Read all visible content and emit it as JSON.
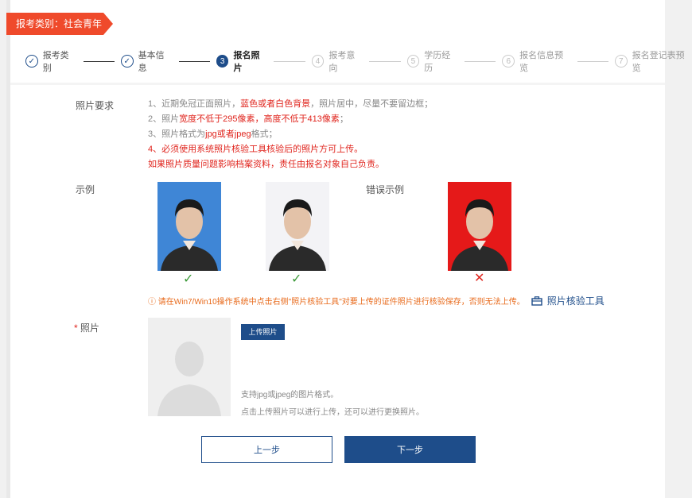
{
  "ribbon": {
    "text": "报考类别：社会青年"
  },
  "steps": [
    {
      "num": "✓",
      "label": "报考类别"
    },
    {
      "num": "✓",
      "label": "基本信息"
    },
    {
      "num": "3",
      "label": "报名照片"
    },
    {
      "num": "4",
      "label": "报考意向"
    },
    {
      "num": "5",
      "label": "学历经历"
    },
    {
      "num": "6",
      "label": "报名信息预览"
    },
    {
      "num": "7",
      "label": "报名登记表预览"
    }
  ],
  "requirements": {
    "label": "照片要求",
    "line1_a": "1、近期免冠正面照片，",
    "line1_b": "蓝色或者白色背景",
    "line1_c": "，照片居中，尽量不要留边框；",
    "line2_a": "2、照片",
    "line2_b": "宽度不低于295像素，高度不低于413像素",
    "line2_c": "；",
    "line3_a": "3、照片格式为",
    "line3_b": "jpg或者jpeg",
    "line3_c": "格式；",
    "line4": "4、必须使用系统照片核验工具核验后的照片方可上传。",
    "line5": "如果照片质量问题影响档案资料，责任由报名对象自己负责。"
  },
  "example": {
    "label": "示例",
    "wrong_label": "错误示例",
    "colors": {
      "blue": "#3f86d6",
      "white": "#f3f3f6",
      "red": "#e51919"
    }
  },
  "warning": {
    "text": "ⓘ 请在Win7/Win10操作系统中点击右侧\"照片核验工具\"对要上传的证件照片进行核验保存，否则无法上传。",
    "tool": "照片核验工具"
  },
  "upload": {
    "label": "照片",
    "button": "上传照片",
    "hint1": "支持jpg或jpeg的图片格式。",
    "hint2": "点击上传照片可以进行上传，还可以进行更换照片。"
  },
  "nav": {
    "prev": "上一步",
    "next": "下一步"
  }
}
